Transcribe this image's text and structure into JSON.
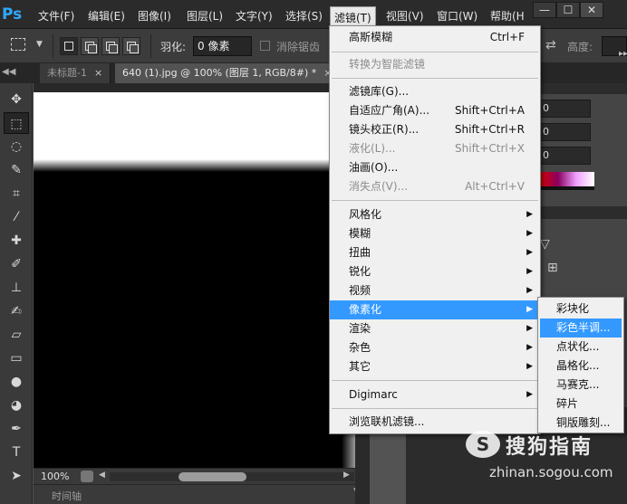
{
  "app": {
    "logo": "Ps"
  },
  "menubar": {
    "items": [
      "文件(F)",
      "编辑(E)",
      "图像(I)",
      "图层(L)",
      "文字(Y)",
      "选择(S)",
      "滤镜(T)",
      "视图(V)",
      "窗口(W)",
      "帮助(H"
    ],
    "active": "滤镜(T)"
  },
  "window_controls": {
    "minimize": "—",
    "restore": "☐",
    "close": "✕"
  },
  "options": {
    "feather_label": "羽化:",
    "feather_value": "0 像素",
    "antialias_label": "消除锯齿",
    "height_label": "高度:"
  },
  "tabs": [
    {
      "label": "未标题-1",
      "close": "×",
      "active": false
    },
    {
      "label": "640 (1).jpg @ 100% (图层 1, RGB/8#) *",
      "close": "×",
      "active": true
    }
  ],
  "status": {
    "zoom": "100%",
    "timeline": "时间轴"
  },
  "right_panel": {
    "field_values": [
      "0",
      "0",
      "0"
    ]
  },
  "filter_menu": {
    "items": [
      {
        "label": "高斯模糊",
        "shortcut": "Ctrl+F",
        "disabled": false
      },
      {
        "label": "转换为智能滤镜",
        "shortcut": "",
        "disabled": true
      },
      {
        "label": "滤镜库(G)...",
        "shortcut": "",
        "disabled": false
      },
      {
        "label": "自适应广角(A)...",
        "shortcut": "Shift+Ctrl+A",
        "disabled": false
      },
      {
        "label": "镜头校正(R)...",
        "shortcut": "Shift+Ctrl+R",
        "disabled": false
      },
      {
        "label": "液化(L)...",
        "shortcut": "Shift+Ctrl+X",
        "disabled": true
      },
      {
        "label": "油画(O)...",
        "shortcut": "",
        "disabled": false
      },
      {
        "label": "消失点(V)...",
        "shortcut": "Alt+Ctrl+V",
        "disabled": true
      },
      {
        "label": "风格化",
        "submenu": true
      },
      {
        "label": "模糊",
        "submenu": true
      },
      {
        "label": "扭曲",
        "submenu": true
      },
      {
        "label": "锐化",
        "submenu": true
      },
      {
        "label": "视频",
        "submenu": true
      },
      {
        "label": "像素化",
        "submenu": true,
        "highlighted": true
      },
      {
        "label": "渲染",
        "submenu": true
      },
      {
        "label": "杂色",
        "submenu": true
      },
      {
        "label": "其它",
        "submenu": true
      },
      {
        "label": "Digimarc",
        "submenu": true
      },
      {
        "label": "浏览联机滤镜...",
        "shortcut": "",
        "disabled": false
      }
    ],
    "submenu_arrow": "▶"
  },
  "pixelate_submenu": {
    "items": [
      "彩块化",
      "彩色半调...",
      "点状化...",
      "晶格化...",
      "马赛克...",
      "碎片",
      "铜版雕刻..."
    ],
    "highlighted": "彩色半调..."
  },
  "watermark": {
    "logo": "S",
    "text": "搜狗指南",
    "url": "zhinan.sogou.com"
  },
  "colors": {
    "highlight": "#3399ff",
    "menu_bg": "#f0f0f0",
    "app_bg": "#535353"
  }
}
